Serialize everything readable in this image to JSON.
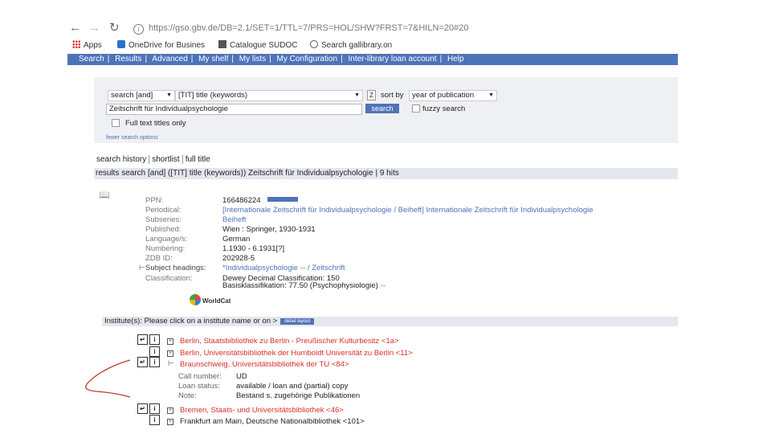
{
  "browser": {
    "url": "https://gso.gbv.de/DB=2.1/SET=1/TTL=7/PRS=HOL/SHW?FRST=7&HILN=20#20",
    "bookmarks": [
      "Apps",
      "OneDrive for Busines",
      "Catalogue SUDOC",
      "Search gallibrary.on"
    ]
  },
  "site_nav": [
    "Search",
    "Results",
    "Advanced",
    "My shelf",
    "My lists",
    "My Configuration",
    "Inter-library loan account",
    "Help"
  ],
  "search_form": {
    "mode_select": "search [and]",
    "field_select": "[TIT] title (keywords)",
    "query": "Zeitschrift für Individualpsychologie",
    "search_button": "search",
    "sort_label": "sort by",
    "sort_select": "year of publication",
    "fuzzy_label": "fuzzy search",
    "fulltext_label": "Full text titles only",
    "more_options": "fewer search options"
  },
  "tabs": [
    "search history",
    "shortlist",
    "full title"
  ],
  "results_summary": "results search [and] ([TIT] title (keywords)) Zeitschrift für Individualpsychologie | 9 hits",
  "record": {
    "ppn_label": "PPN:",
    "ppn": "166486224",
    "periodical_label": "Periodical:",
    "periodical_a": "[Internationale Zeitschrift für Individualpsychologie / Beiheft]",
    "periodical_b": "Internationale Zeitschrift für Individualpsychologie",
    "subseries_label": "Subseries:",
    "subseries": "Beiheft",
    "published_label": "Published:",
    "published": "Wien : Springer, 1930-1931",
    "language_label": "Language/s:",
    "language": "German",
    "numbering_label": "Numbering:",
    "numbering": "1.1930 - 6.1931[?]",
    "zdb_label": "ZDB ID:",
    "zdb": "202928-5",
    "subject_label": "Subject headings:",
    "subject_a": "*Individualpsychologie",
    "subject_b": "Zeitschrift",
    "classification_label": "Classification:",
    "classification_a": "Dewey Decimal Classification: 150",
    "classification_b": "Basisklassifikation: 77.50 (Psychophysiologie)",
    "worldcat": "WorldCat"
  },
  "institutes": {
    "heading": "Institute(s): Please click on a institute name or on >",
    "detail_button": "detail layout",
    "items": [
      "Berlin, Staatsbibliothek zu Berlin - Preußischer Kulturbesitz <1a>",
      "Berlin, Universitätsbibliothek der Humboldt Universität zu Berlin <11>",
      "Braunschweig, Universitätsbibliothek der TU <84>",
      "Bremen, Staats- und Universitätsbibliothek <46>",
      "Frankfurt am Main, Deutsche Nationalbibliothek <101>"
    ],
    "detail": {
      "call_number_label": "Call number:",
      "call_number": "UD",
      "loan_status_label": "Loan status:",
      "loan_status": "available / loan and (partial) copy",
      "note_label": "Note:",
      "note": "Bestand s. zugehörige Publikationen"
    }
  }
}
